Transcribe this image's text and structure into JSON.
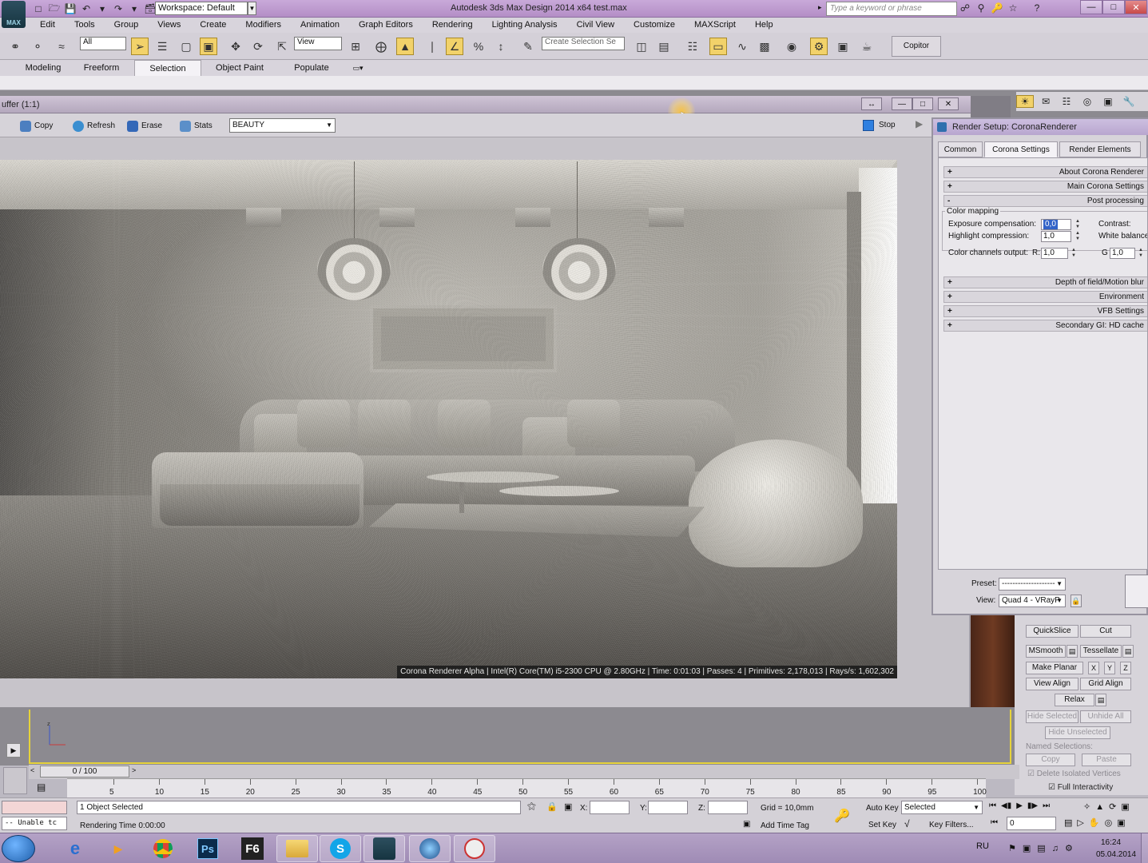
{
  "titlebar": {
    "workspace": "Workspace: Default",
    "app_title": "Autodesk 3ds Max Design 2014 x64     test.max",
    "search_placeholder": "Type a keyword or phrase",
    "logo": "MAX"
  },
  "menu": [
    "Edit",
    "Tools",
    "Group",
    "Views",
    "Create",
    "Modifiers",
    "Animation",
    "Graph Editors",
    "Rendering",
    "Lighting Analysis",
    "Civil View",
    "Customize",
    "MAXScript",
    "Help"
  ],
  "toolbar": {
    "selection_filter": "All",
    "ref_coord": "View",
    "named_selection_placeholder": "Create Selection Se",
    "copitor": "Copitor"
  },
  "ribbon": {
    "tabs": [
      "Modeling",
      "Freeform",
      "Selection",
      "Object Paint",
      "Populate"
    ],
    "active": "Selection"
  },
  "framebuffer": {
    "title": "uffer (1:1)",
    "buttons": {
      "copy": "Copy",
      "refresh": "Refresh",
      "erase": "Erase",
      "stats": "Stats",
      "stop": "Stop"
    },
    "channel": "BEAUTY",
    "status": "Corona Renderer Alpha | Intel(R) Core(TM) i5-2300 CPU @ 2.80GHz | Time: 0:01:03 | Passes: 4 | Primitives: 2,178,013 | Rays/s: 1,602,302"
  },
  "render_setup": {
    "title": "Render Setup: CoronaRenderer",
    "tabs": [
      "Common",
      "Corona Settings",
      "Render Elements"
    ],
    "active_tab": "Corona Settings",
    "rollouts_top": [
      {
        "sign": "+",
        "label": "About Corona Renderer"
      },
      {
        "sign": "+",
        "label": "Main Corona Settings"
      },
      {
        "sign": "-",
        "label": "Post processing"
      }
    ],
    "color_mapping": {
      "group": "Color mapping",
      "exposure_label": "Exposure compensation:",
      "exposure_value": "0,0",
      "highlight_label": "Highlight compression:",
      "highlight_value": "1,0",
      "channels_label": "Color channels output:",
      "r_label": "R:",
      "r_value": "1,0",
      "g_label": "G",
      "g_value": "1,0",
      "contrast_label": "Contrast:",
      "white_balance_label": "White balance"
    },
    "rollouts_bottom": [
      {
        "sign": "+",
        "label": "Depth of field/Motion blur"
      },
      {
        "sign": "+",
        "label": "Environment"
      },
      {
        "sign": "+",
        "label": "VFB Settings"
      },
      {
        "sign": "+",
        "label": "Secondary GI: HD cache"
      }
    ],
    "preset_label": "Preset:",
    "preset_value": "--------------------",
    "view_label": "View:",
    "view_value": "Quad 4 - VRayP"
  },
  "modifier": {
    "quickslice": "QuickSlice",
    "cut": "Cut",
    "msmooth": "MSmooth",
    "tessellate": "Tessellate",
    "make_planar": "Make Planar",
    "x": "X",
    "y": "Y",
    "z": "Z",
    "view_align": "View Align",
    "grid_align": "Grid Align",
    "relax": "Relax",
    "hide_selected": "Hide Selected",
    "unhide_all": "Unhide All",
    "hide_unselected": "Hide Unselected",
    "named_selections": "Named Selections:",
    "copy": "Copy",
    "paste": "Paste",
    "delete_isolated": "Delete Isolated Vertices",
    "full_interactivity": "Full Interactivity"
  },
  "timeline": {
    "slider": "0 / 100",
    "ticks": [
      "5",
      "10",
      "15",
      "20",
      "25",
      "30",
      "35",
      "40",
      "45",
      "50",
      "55",
      "60",
      "65",
      "70",
      "75",
      "80",
      "85",
      "90",
      "95",
      "100"
    ]
  },
  "status": {
    "selection": "1 Object Selected",
    "rendering_time": "Rendering Time  0:00:00",
    "script_listener": "-- Unable tc",
    "x_label": "X:",
    "y_label": "Y:",
    "z_label": "Z:",
    "grid": "Grid = 10,0mm",
    "add_time_tag": "Add Time Tag",
    "auto_key": "Auto Key",
    "selected": "Selected",
    "set_key": "Set Key",
    "key_filters": "Key Filters...",
    "frame": "0"
  },
  "taskbar": {
    "apps": [
      "ie",
      "media",
      "chrome",
      "Ps",
      "F6",
      "explorer",
      "skype",
      "3dsmax",
      "app",
      "clock"
    ],
    "ps_label": "Ps",
    "f6_label": "F6",
    "skype_label": "S",
    "lang": "RU",
    "time": "16:24",
    "date": "05.04.2014"
  },
  "colors": {
    "accent_purple": "#b48ec6",
    "highlight_yellow": "#f2d26a",
    "viewport_border": "#e6d33a",
    "stop_blue": "#2f7fe0"
  }
}
